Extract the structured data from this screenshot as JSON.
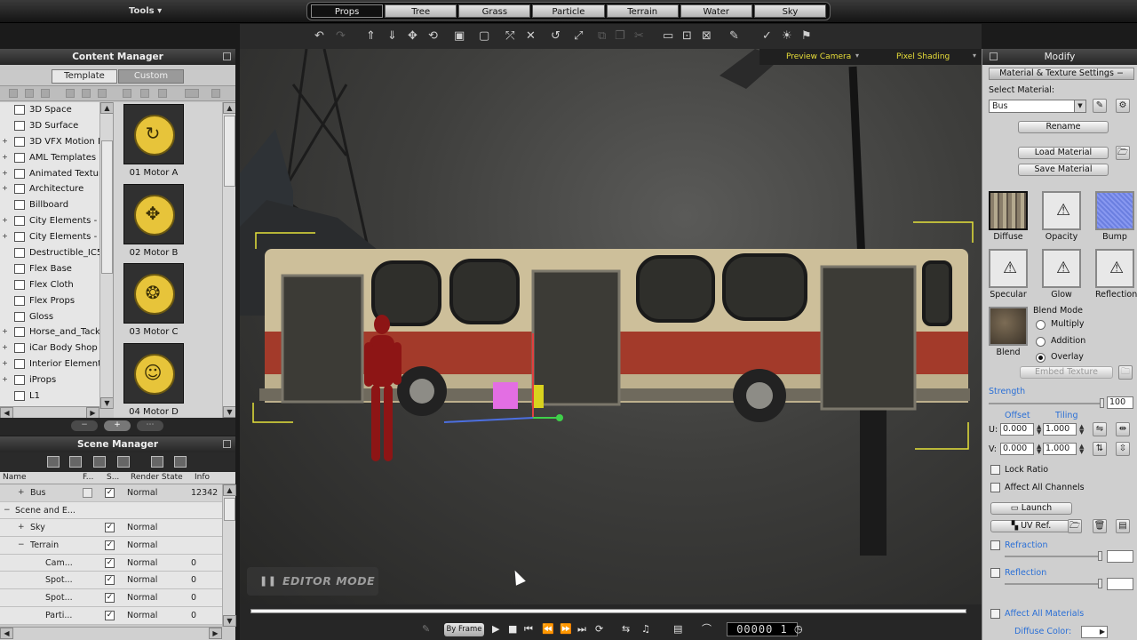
{
  "top_bar": {
    "tools_label": "Tools",
    "tabs": [
      {
        "label": "Props",
        "active": true
      },
      {
        "label": "Tree",
        "active": false
      },
      {
        "label": "Grass",
        "active": false
      },
      {
        "label": "Particle",
        "active": false
      },
      {
        "label": "Terrain",
        "active": false
      },
      {
        "label": "Water",
        "active": false
      },
      {
        "label": "Sky",
        "active": false
      }
    ]
  },
  "toolbar": {
    "icons": [
      "undo-icon",
      "redo-icon",
      "move-up-icon",
      "move-down-icon",
      "move-icon",
      "rotate-icon",
      "scale-icon",
      "align-icon",
      "transform-icon",
      "snap-icon",
      "orbit-icon",
      "fit-icon",
      "copy-icon",
      "paste-icon",
      "delete-icon",
      "frame-icon",
      "camera-icon",
      "view-icon",
      "brush-icon",
      "check-icon",
      "light-icon",
      "flag-icon"
    ]
  },
  "content_manager": {
    "title": "Content Manager",
    "tabs": [
      {
        "label": "Template",
        "active": true
      },
      {
        "label": "Custom",
        "active": false
      }
    ],
    "tree": [
      {
        "label": "3D Space",
        "expandable": false
      },
      {
        "label": "3D Surface",
        "expandable": false
      },
      {
        "label": "3D VFX Motion Mo",
        "expandable": true
      },
      {
        "label": "AML Templates",
        "expandable": true
      },
      {
        "label": "Animated Texture",
        "expandable": true
      },
      {
        "label": "Architecture",
        "expandable": true
      },
      {
        "label": "Billboard",
        "expandable": false
      },
      {
        "label": "City Elements - Fo",
        "expandable": true
      },
      {
        "label": "City Elements - Me",
        "expandable": true
      },
      {
        "label": "Destructible_IC5",
        "expandable": false
      },
      {
        "label": "Flex Base",
        "expandable": false
      },
      {
        "label": "Flex Cloth",
        "expandable": false
      },
      {
        "label": "Flex Props",
        "expandable": false
      },
      {
        "label": "Gloss",
        "expandable": false
      },
      {
        "label": "Horse_and_Tack",
        "expandable": true
      },
      {
        "label": "iCar Body Shop",
        "expandable": true
      },
      {
        "label": "Interior Element V",
        "expandable": true
      },
      {
        "label": "iProps",
        "expandable": true
      },
      {
        "label": "L1",
        "expandable": false
      }
    ],
    "thumbnails": [
      {
        "label": "01 Motor A",
        "glyph": "↻"
      },
      {
        "label": "02 Motor B",
        "glyph": "✥"
      },
      {
        "label": "03 Motor C",
        "glyph": "❂"
      },
      {
        "label": "04 Motor D",
        "glyph": "☺"
      }
    ]
  },
  "scene_manager": {
    "title": "Scene Manager",
    "columns": [
      "Name",
      "F...",
      "S...",
      "Render State",
      "Info"
    ],
    "rows": [
      {
        "expander": "+",
        "name": "Bus",
        "indent": 1,
        "freeze": true,
        "show": true,
        "render_state": "Normal",
        "info": "12342",
        "selected": true
      },
      {
        "expander": "−",
        "name": "Scene and E...",
        "indent": 0,
        "freeze": false,
        "show": false,
        "render_state": "",
        "info": "",
        "selected": false
      },
      {
        "expander": "+",
        "name": "Sky",
        "indent": 1,
        "freeze": false,
        "show": true,
        "render_state": "Normal",
        "info": "",
        "selected": false
      },
      {
        "expander": "−",
        "name": "Terrain",
        "indent": 1,
        "freeze": false,
        "show": true,
        "render_state": "Normal",
        "info": "",
        "selected": false
      },
      {
        "expander": "",
        "name": "Cam...",
        "indent": 2,
        "freeze": false,
        "show": true,
        "render_state": "Normal",
        "info": "0",
        "selected": false
      },
      {
        "expander": "",
        "name": "Spot...",
        "indent": 2,
        "freeze": false,
        "show": true,
        "render_state": "Normal",
        "info": "0",
        "selected": false
      },
      {
        "expander": "",
        "name": "Spot...",
        "indent": 2,
        "freeze": false,
        "show": true,
        "render_state": "Normal",
        "info": "0",
        "selected": false
      },
      {
        "expander": "",
        "name": "Parti...",
        "indent": 2,
        "freeze": false,
        "show": true,
        "render_state": "Normal",
        "info": "0",
        "selected": false
      }
    ]
  },
  "viewport": {
    "camera_label": "Preview Camera",
    "shading_label": "Pixel Shading",
    "mode_label": "EDITOR MODE",
    "header_color": "#e9df39"
  },
  "timeline": {
    "by_frame_label": "By Frame",
    "frame_counter": "00000 1",
    "controls": [
      "play-icon",
      "stop-icon",
      "start-icon",
      "prev-key-icon",
      "next-key-icon",
      "end-icon",
      "loop-icon"
    ]
  },
  "modify": {
    "title": "Modify",
    "section_title": "Material & Texture Settings",
    "select_material_label": "Select Material:",
    "material_value": "Bus",
    "rename_label": "Rename",
    "load_material_label": "Load Material",
    "save_material_label": "Save Material",
    "channels": [
      {
        "label": "Diffuse",
        "style": "diffuse",
        "selected": true
      },
      {
        "label": "Opacity",
        "style": "warn",
        "selected": false
      },
      {
        "label": "Bump",
        "style": "bump",
        "selected": false
      },
      {
        "label": "Specular",
        "style": "warn",
        "selected": false
      },
      {
        "label": "Glow",
        "style": "warn",
        "selected": false
      },
      {
        "label": "Reflection",
        "style": "warn",
        "selected": false
      }
    ],
    "blend": {
      "label": "Blend",
      "mode_label": "Blend Mode",
      "options": [
        {
          "label": "Multiply",
          "selected": false
        },
        {
          "label": "Addition",
          "selected": false
        },
        {
          "label": "Overlay",
          "selected": true
        }
      ],
      "embed_label": "Embed Texture"
    },
    "strength_label": "Strength",
    "strength_value": "100",
    "offset_label": "Offset",
    "tiling_label": "Tiling",
    "u_label": "U:",
    "v_label": "V:",
    "u_offset": "0.000",
    "u_tiling": "1.000",
    "v_offset": "0.000",
    "v_tiling": "1.000",
    "lock_ratio_label": "Lock Ratio",
    "affect_all_channels_label": "Affect All Channels",
    "launch_label": "Launch",
    "uv_ref_label": "UV Ref.",
    "refraction_label": "Refraction",
    "reflection_label": "Reflection",
    "affect_all_materials_label": "Affect All Materials",
    "diffuse_color_label": "Diffuse Color:",
    "accent_color": "#2a6fd6"
  }
}
